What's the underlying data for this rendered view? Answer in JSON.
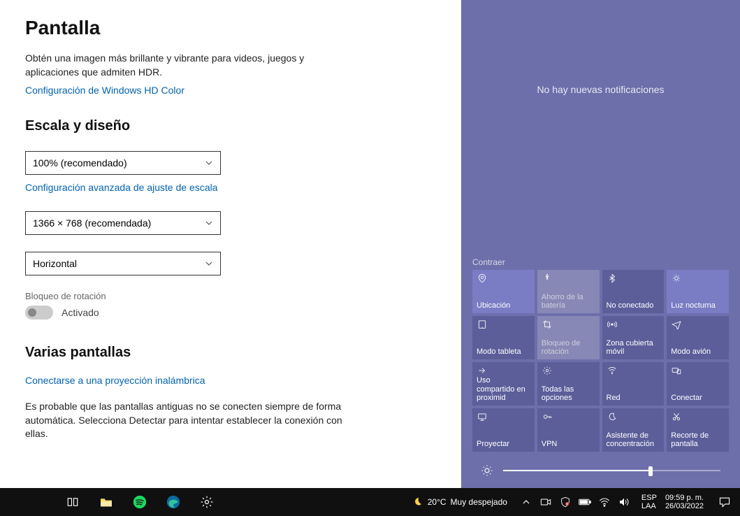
{
  "settings": {
    "title": "Pantalla",
    "hdr_desc": "Obtén una imagen más brillante y vibrante para videos, juegos y aplicaciones que admiten HDR.",
    "hdr_link": "Configuración de Windows HD Color",
    "scale_section": "Escala y diseño",
    "scale_value": "100% (recomendado)",
    "adv_scale_link": "Configuración avanzada de ajuste de escala",
    "resolution_value": "1366 × 768 (recomendada)",
    "orientation_value": "Horizontal",
    "rotation_lock_label": "Bloqueo de rotación",
    "rotation_lock_state": "Activado",
    "multi_section": "Varias pantallas",
    "wireless_link": "Conectarse a una proyección inalámbrica",
    "old_display_desc": "Es probable que las pantallas antiguas no se conecten siempre de forma automática. Selecciona Detectar para intentar establecer la conexión con ellas."
  },
  "action_center": {
    "empty_msg": "No hay nuevas notificaciones",
    "collapse_label": "Contraer",
    "tiles": [
      {
        "label": "Ubicación",
        "icon": "location",
        "state": "active"
      },
      {
        "label": "Ahorro de la batería",
        "icon": "battery",
        "state": "disabled"
      },
      {
        "label": "No conectado",
        "icon": "bluetooth",
        "state": "normal"
      },
      {
        "label": "Luz nocturna",
        "icon": "night",
        "state": "active"
      },
      {
        "label": "Modo tableta",
        "icon": "tablet",
        "state": "normal"
      },
      {
        "label": "Bloqueo de rotación",
        "icon": "rotation",
        "state": "disabled"
      },
      {
        "label": "Zona cubierta móvil",
        "icon": "hotspot",
        "state": "normal"
      },
      {
        "label": "Modo avión",
        "icon": "airplane",
        "state": "normal"
      },
      {
        "label": "Uso compartido en proximid",
        "icon": "share",
        "state": "normal"
      },
      {
        "label": "Todas las opciones",
        "icon": "gear",
        "state": "normal"
      },
      {
        "label": "Red",
        "icon": "wifi",
        "state": "normal"
      },
      {
        "label": "Conectar",
        "icon": "connect",
        "state": "normal"
      },
      {
        "label": "Proyectar",
        "icon": "project",
        "state": "normal"
      },
      {
        "label": "VPN",
        "icon": "vpn",
        "state": "normal"
      },
      {
        "label": "Asistente de concentración",
        "icon": "focus",
        "state": "normal"
      },
      {
        "label": "Recorte de pantalla",
        "icon": "snip",
        "state": "normal"
      }
    ],
    "brightness_pct": 68
  },
  "taskbar": {
    "weather_temp": "20°C",
    "weather_cond": "Muy despejado",
    "lang1": "ESP",
    "lang2": "LAA",
    "time": "09:59 p. m.",
    "date": "26/03/2022"
  }
}
